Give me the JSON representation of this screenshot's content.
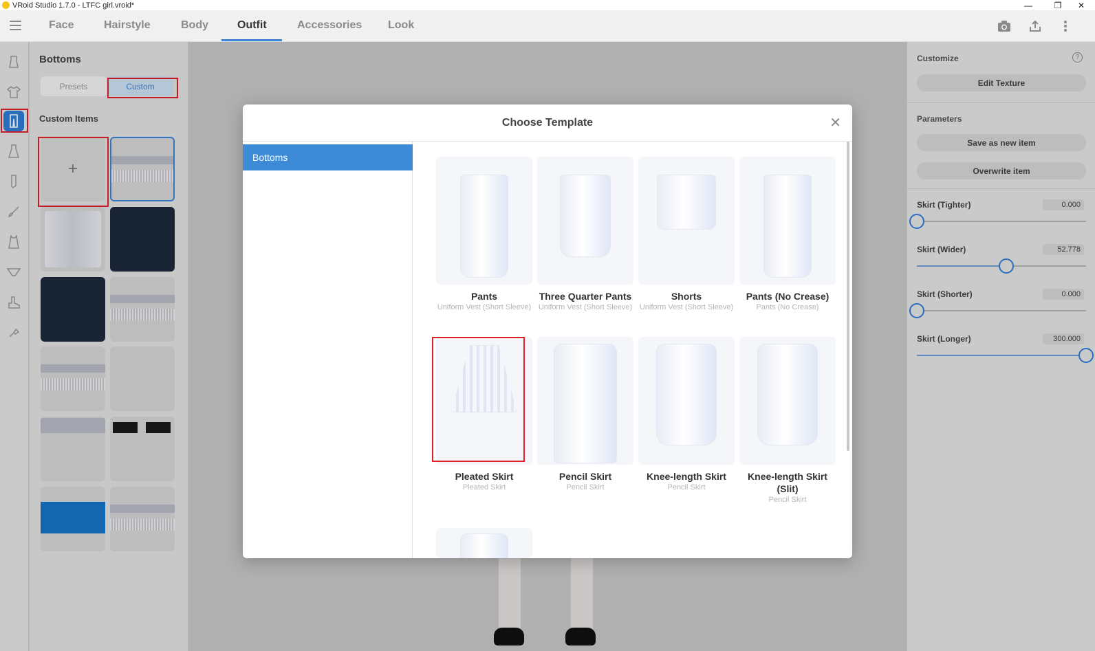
{
  "window": {
    "title": "VRoid Studio 1.7.0 - LTFC girl.vroid*",
    "minimize_glyph": "—",
    "restore_glyph": "❐",
    "close_glyph": "✕"
  },
  "topnav": {
    "tabs": [
      {
        "label": "Face"
      },
      {
        "label": "Hairstyle"
      },
      {
        "label": "Body"
      },
      {
        "label": "Outfit"
      },
      {
        "label": "Accessories"
      },
      {
        "label": "Look"
      }
    ],
    "active_tab": "Outfit"
  },
  "left_panel": {
    "title": "Bottoms",
    "segments": {
      "presets": "Presets",
      "custom": "Custom"
    },
    "section_label": "Custom Items",
    "add_glyph": "+"
  },
  "right_panel": {
    "customize_label": "Customize",
    "help_glyph": "?",
    "edit_texture": "Edit Texture",
    "parameters_label": "Parameters",
    "save_as_new": "Save as new item",
    "overwrite": "Overwrite item",
    "sliders": [
      {
        "label": "Skirt (Tighter)",
        "value": "0.000",
        "fraction": 0.0
      },
      {
        "label": "Skirt (Wider)",
        "value": "52.778",
        "fraction": 0.53
      },
      {
        "label": "Skirt (Shorter)",
        "value": "0.000",
        "fraction": 0.0
      },
      {
        "label": "Skirt (Longer)",
        "value": "300.000",
        "fraction": 1.0
      }
    ]
  },
  "dialog": {
    "title": "Choose Template",
    "close_glyph": "✕",
    "category": "Bottoms",
    "templates": [
      {
        "name": "Pants",
        "sub": "Uniform Vest (Short Sleeve)"
      },
      {
        "name": "Three Quarter Pants",
        "sub": "Uniform Vest (Short Sleeve)"
      },
      {
        "name": "Shorts",
        "sub": "Uniform Vest (Short Sleeve)"
      },
      {
        "name": "Pants (No Crease)",
        "sub": "Pants (No Crease)"
      },
      {
        "name": "Pleated Skirt",
        "sub": "Pleated Skirt"
      },
      {
        "name": "Pencil Skirt",
        "sub": "Pencil Skirt"
      },
      {
        "name": "Knee-length Skirt",
        "sub": "Pencil Skirt"
      },
      {
        "name": "Knee-length Skirt (Slit)",
        "sub": "Pencil Skirt"
      }
    ]
  },
  "colors": {
    "accent": "#2f7ed8",
    "highlight_box": "#e0202a"
  }
}
